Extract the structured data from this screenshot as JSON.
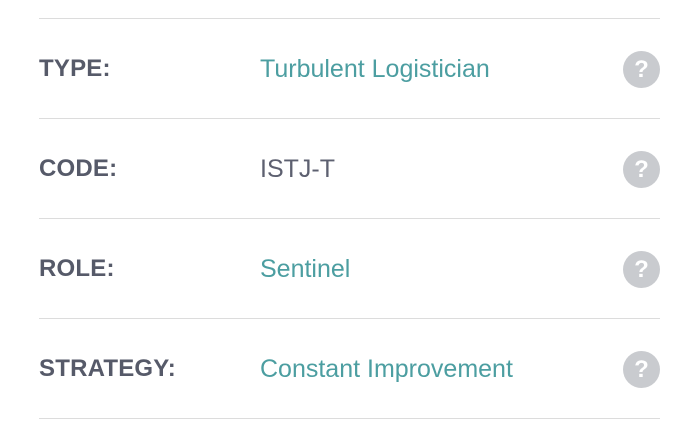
{
  "rows": [
    {
      "label": "TYPE:",
      "value": "Turbulent Logistician",
      "value_style": "accent",
      "help_icon": "question-icon",
      "help_glyph": "?"
    },
    {
      "label": "CODE:",
      "value": "ISTJ-T",
      "value_style": "plain",
      "help_icon": "question-icon",
      "help_glyph": "?"
    },
    {
      "label": "ROLE:",
      "value": "Sentinel",
      "value_style": "accent",
      "help_icon": "question-icon",
      "help_glyph": "?"
    },
    {
      "label": "STRATEGY:",
      "value": "Constant Improvement",
      "value_style": "accent",
      "help_icon": "question-icon",
      "help_glyph": "?"
    }
  ],
  "colors": {
    "label": "#565a69",
    "accent": "#4c9ea1",
    "plain_value": "#5d6070",
    "divider": "#dcdcdc",
    "help_bg": "#c9cbcf"
  }
}
